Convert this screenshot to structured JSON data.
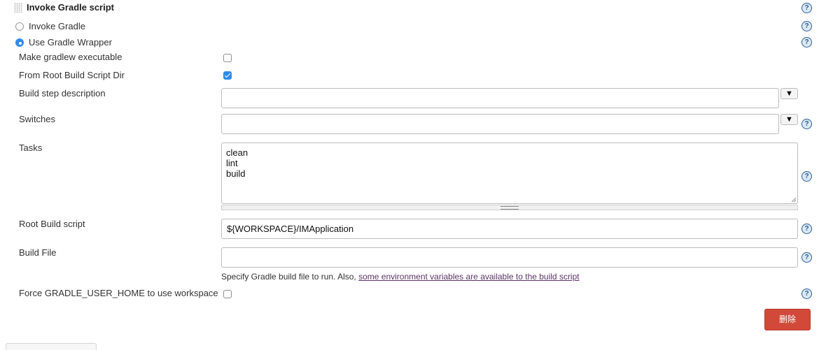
{
  "section": {
    "title": "Invoke Gradle script"
  },
  "options": {
    "invoke_gradle": "Invoke Gradle",
    "use_gradle_wrapper": "Use Gradle Wrapper",
    "selected": "use_gradle_wrapper"
  },
  "fields": {
    "make_gradlew_executable": {
      "label": "Make gradlew executable",
      "checked": false
    },
    "from_root_build_script_dir": {
      "label": "From Root Build Script Dir",
      "checked": true
    },
    "build_step_description": {
      "label": "Build step description",
      "value": ""
    },
    "switches": {
      "label": "Switches",
      "value": ""
    },
    "tasks": {
      "label": "Tasks",
      "lines": [
        "clean",
        "lint",
        "build"
      ]
    },
    "root_build_script": {
      "label": "Root Build script",
      "value": "${WORKSPACE}/IMApplication"
    },
    "build_file": {
      "label": "Build File",
      "value": "",
      "hint": "Specify Gradle build file to run. Also, ",
      "hint_link": "some environment variables are available to the build script"
    },
    "force_gradle_user_home": {
      "label": "Force GRADLE_USER_HOME to use workspace",
      "checked": false
    }
  },
  "icons": {
    "help": "?",
    "dropdown": "▼"
  },
  "buttons": {
    "delete": "删除"
  },
  "colors": {
    "accent": "#2f8bea",
    "delete": "#d24939",
    "help": "#2a5e96",
    "link": "#5c3566"
  }
}
